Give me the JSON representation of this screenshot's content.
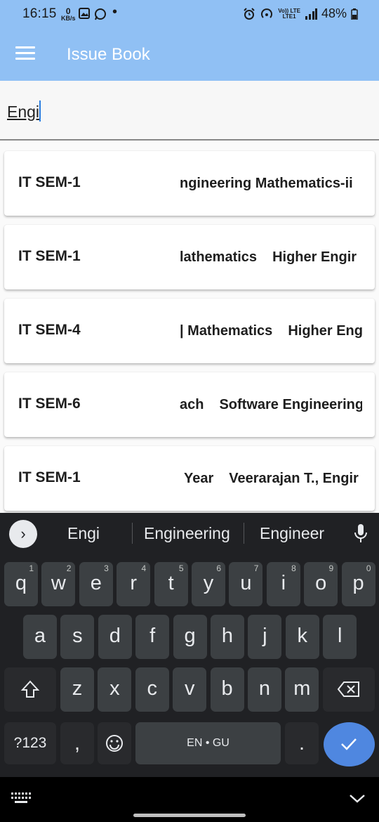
{
  "status_bar": {
    "time": "16:15",
    "net_speed_value": "0",
    "net_speed_unit": "KB/s",
    "lte_top": "Vo)) LTE",
    "lte_bottom": "LTE1",
    "battery": "48%"
  },
  "app_bar": {
    "title": "Issue Book",
    "menu_icon": "hamburger-menu-icon"
  },
  "search": {
    "value": "Engi"
  },
  "results": [
    {
      "semester": "IT SEM-1",
      "books": [
        "ngineering Mathematics-ii"
      ],
      "offset": 6
    },
    {
      "semester": "IT SEM-1",
      "books": [
        "lathematics",
        "Higher Engir"
      ],
      "offset": 6
    },
    {
      "semester": "IT SEM-4",
      "books": [
        "| Mathematics",
        "Higher Eng"
      ],
      "offset": 6
    },
    {
      "semester": "IT SEM-6",
      "books": [
        "ach",
        "Software Engineering"
      ],
      "offset": 6
    },
    {
      "semester": "IT SEM-1",
      "books": [
        "Year",
        "Veerarajan T., Engir"
      ],
      "offset": 12
    }
  ],
  "keyboard": {
    "suggestions": [
      "Engi",
      "Engineering",
      "Engineer"
    ],
    "row1": [
      {
        "k": "q",
        "n": "1"
      },
      {
        "k": "w",
        "n": "2"
      },
      {
        "k": "e",
        "n": "3"
      },
      {
        "k": "r",
        "n": "4"
      },
      {
        "k": "t",
        "n": "5"
      },
      {
        "k": "y",
        "n": "6"
      },
      {
        "k": "u",
        "n": "7"
      },
      {
        "k": "i",
        "n": "8"
      },
      {
        "k": "o",
        "n": "9"
      },
      {
        "k": "p",
        "n": "0"
      }
    ],
    "row2": [
      "a",
      "s",
      "d",
      "f",
      "g",
      "h",
      "j",
      "k",
      "l"
    ],
    "row3": [
      "z",
      "x",
      "c",
      "v",
      "b",
      "n",
      "m"
    ],
    "symbols_label": "?123",
    "comma": ",",
    "space_label": "EN • GU",
    "period": ".",
    "icons": {
      "expand": "chevron-right-icon",
      "mic": "microphone-icon",
      "shift": "shift-icon",
      "backspace": "backspace-icon",
      "emoji": "emoji-icon",
      "enter": "checkmark-icon"
    }
  },
  "colors": {
    "app_bar": "#90c0f4",
    "keyboard_bg": "#202124",
    "key_bg": "#3c4043",
    "enter_key": "#4f87e0"
  }
}
